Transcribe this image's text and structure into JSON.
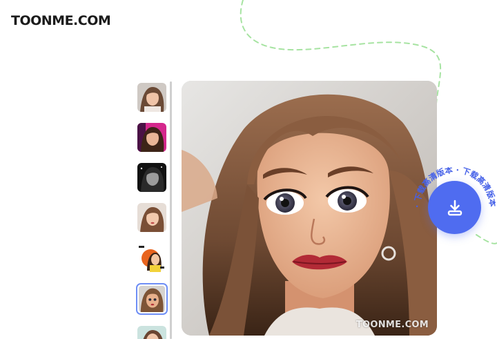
{
  "brand": {
    "logo_text": "TOONME.COM"
  },
  "thumbnails": [
    {
      "name": "thumb-original-photo",
      "selected": false
    },
    {
      "name": "thumb-pink-background",
      "selected": false
    },
    {
      "name": "thumb-dark-sparkle",
      "selected": false
    },
    {
      "name": "thumb-soft-portrait",
      "selected": false
    },
    {
      "name": "thumb-illustrated-sticker",
      "selected": false
    },
    {
      "name": "thumb-cartoon-toon",
      "selected": true
    },
    {
      "name": "thumb-next-style",
      "selected": false
    }
  ],
  "preview": {
    "watermark": "TOONME.COM"
  },
  "download": {
    "ring_text": "· 下载高清版本 · 下载高清版本",
    "icon": "download-icon",
    "button_color": "#4f6cf0"
  },
  "colors": {
    "accent": "#4f6cf0",
    "decorative_dash": "#a6e3a1",
    "selected_border": "#6e8ef5"
  }
}
